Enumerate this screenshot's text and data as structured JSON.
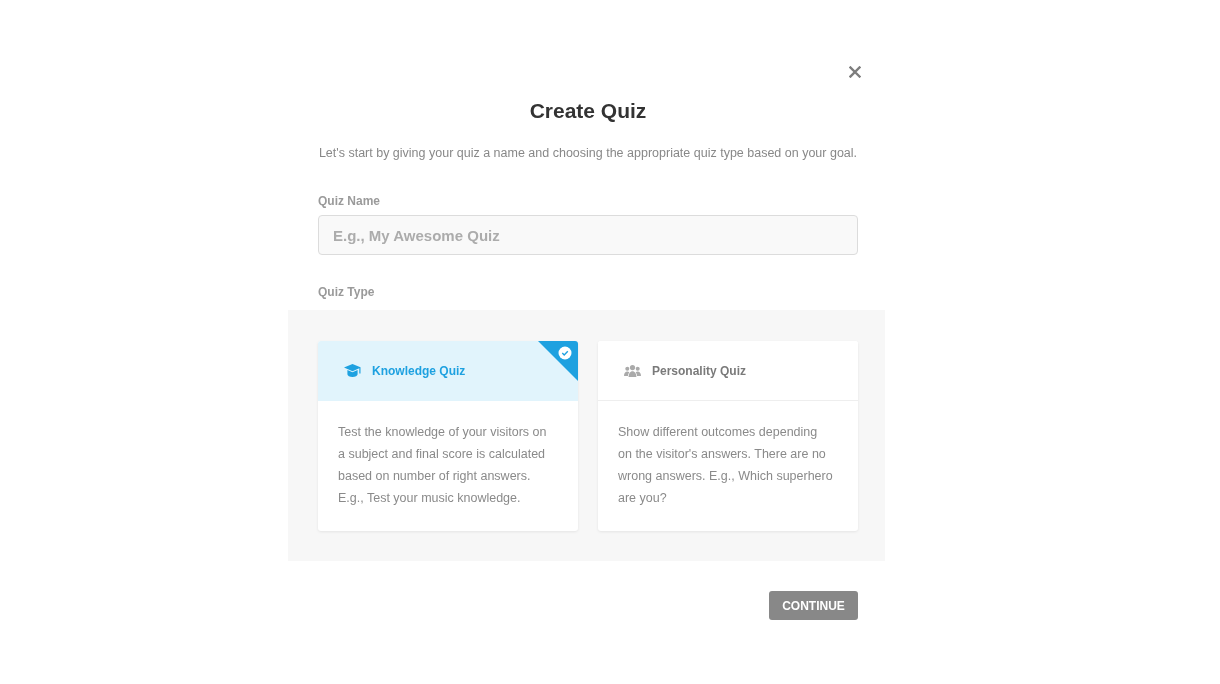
{
  "dialog": {
    "title": "Create Quiz",
    "subtitle": "Let's start by giving your quiz a name and choosing the appropriate quiz type based on your goal."
  },
  "quiz_name": {
    "label": "Quiz Name",
    "placeholder": "E.g., My Awesome Quiz"
  },
  "quiz_type": {
    "label": "Quiz Type",
    "options": [
      {
        "kind": "knowledge",
        "title": "Knowledge Quiz",
        "description": "Test the knowledge of your visitors on a subject and final score is calculated based on number of right answers. E.g., Test your music knowledge.",
        "selected": true
      },
      {
        "kind": "personality",
        "title": "Personality Quiz",
        "description": "Show different outcomes depending on the visitor's answers. There are no wrong answers. E.g., Which superhero are you?",
        "selected": false
      }
    ]
  },
  "continue_button": {
    "label": "CONTINUE"
  }
}
